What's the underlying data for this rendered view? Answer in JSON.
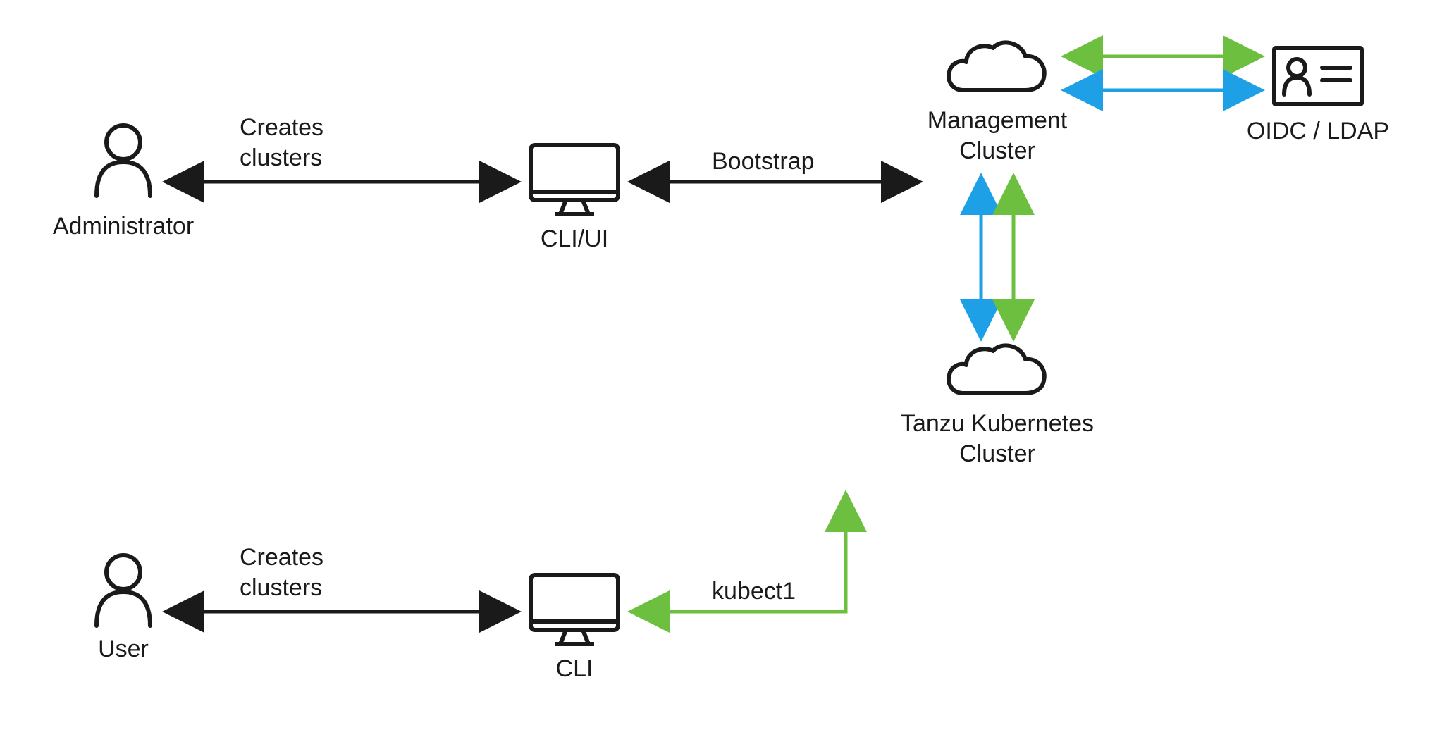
{
  "colors": {
    "black": "#1a1a1a",
    "green": "#6cbf3f",
    "blue": "#1ea0e6"
  },
  "nodes": {
    "admin": {
      "label": "Administrator"
    },
    "user": {
      "label": "User"
    },
    "cliui": {
      "label": "CLI/UI"
    },
    "cli": {
      "label": "CLI"
    },
    "mgmt": {
      "label": "Management\nCluster"
    },
    "tkc": {
      "label": "Tanzu Kubernetes\nCluster"
    },
    "idp": {
      "label": "OIDC / LDAP"
    }
  },
  "edge_labels": {
    "admin_to_cliui": "Creates\nclusters",
    "user_to_cli": "Creates\nclusters",
    "cliui_to_mgmt": "Bootstrap",
    "cli_to_tkc": "kubect1"
  }
}
